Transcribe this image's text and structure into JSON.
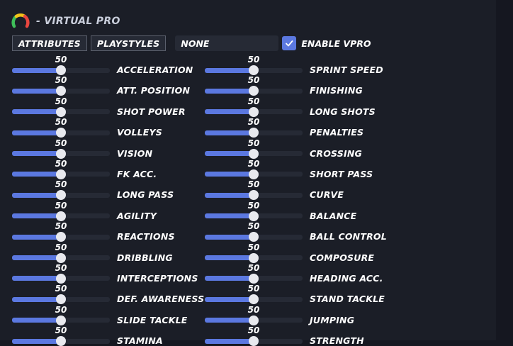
{
  "header": {
    "title": "- VIRTUAL PRO",
    "logo_icon": "speedometer-icon"
  },
  "toolbar": {
    "attributes_label": "ATTRIBUTES",
    "playstyles_label": "PLAYSTYLES",
    "preset_value": "NONE",
    "enable_checked": true,
    "enable_label": "ENABLE VPRO"
  },
  "slider_range": {
    "min": 0,
    "max": 100
  },
  "colors": {
    "accent": "#5b78e0",
    "panel": "#1b1e27",
    "track": "#262a35",
    "thumb": "#e8e9ee"
  },
  "attributes": {
    "left": [
      {
        "label": "ACCELERATION",
        "value": 50
      },
      {
        "label": "ATT. POSITION",
        "value": 50
      },
      {
        "label": "SHOT POWER",
        "value": 50
      },
      {
        "label": "VOLLEYS",
        "value": 50
      },
      {
        "label": "VISION",
        "value": 50
      },
      {
        "label": "FK ACC.",
        "value": 50
      },
      {
        "label": "LONG PASS",
        "value": 50
      },
      {
        "label": "AGILITY",
        "value": 50
      },
      {
        "label": "REACTIONS",
        "value": 50
      },
      {
        "label": "DRIBBLING",
        "value": 50
      },
      {
        "label": "INTERCEPTIONS",
        "value": 50
      },
      {
        "label": "DEF. AWARENESS",
        "value": 50
      },
      {
        "label": "SLIDE TACKLE",
        "value": 50
      },
      {
        "label": "STAMINA",
        "value": 50
      }
    ],
    "right": [
      {
        "label": "SPRINT SPEED",
        "value": 50
      },
      {
        "label": "FINISHING",
        "value": 50
      },
      {
        "label": "LONG SHOTS",
        "value": 50
      },
      {
        "label": "PENALTIES",
        "value": 50
      },
      {
        "label": "CROSSING",
        "value": 50
      },
      {
        "label": "SHORT PASS",
        "value": 50
      },
      {
        "label": "CURVE",
        "value": 50
      },
      {
        "label": "BALANCE",
        "value": 50
      },
      {
        "label": "BALL CONTROL",
        "value": 50
      },
      {
        "label": "COMPOSURE",
        "value": 50
      },
      {
        "label": "HEADING ACC.",
        "value": 50
      },
      {
        "label": "STAND TACKLE",
        "value": 50
      },
      {
        "label": "JUMPING",
        "value": 50
      },
      {
        "label": "STRENGTH",
        "value": 50
      }
    ]
  }
}
